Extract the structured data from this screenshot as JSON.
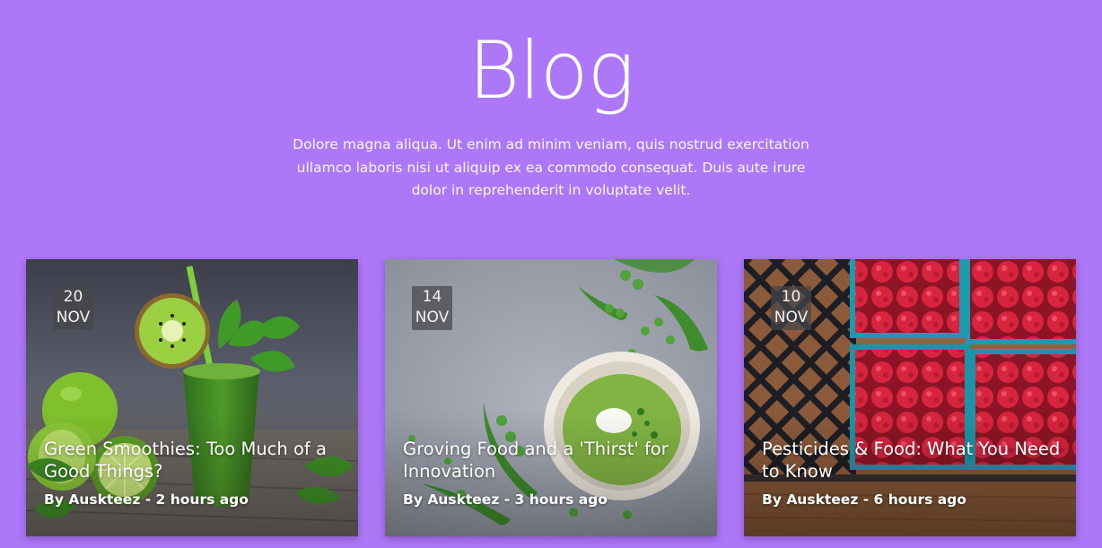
{
  "header": {
    "title": "Blog",
    "intro": "Dolore magna aliqua. Ut enim ad minim veniam, quis nostrud exercitation ullamco laboris nisi ut aliquip ex ea commodo consequat. Duis aute irure dolor in reprehenderit in voluptate velit."
  },
  "posts": [
    {
      "day": "20",
      "month": "NOV",
      "title": "Green Smoothies: Too Much of a Good Things?",
      "meta": "By Auskteez - 2 hours ago",
      "image": "green-smoothie-photo"
    },
    {
      "day": "14",
      "month": "NOV",
      "title": "Groving Food and a 'Thirst' for Innovation",
      "meta": "By Auskteez - 3 hours ago",
      "image": "pea-soup-photo"
    },
    {
      "day": "10",
      "month": "NOV",
      "title": "Pesticides & Food: What You Need to Know",
      "meta": "By Auskteez - 6 hours ago",
      "image": "raspberries-photo"
    }
  ],
  "colors": {
    "background": "#ad78f7",
    "text": "#ffffff"
  }
}
